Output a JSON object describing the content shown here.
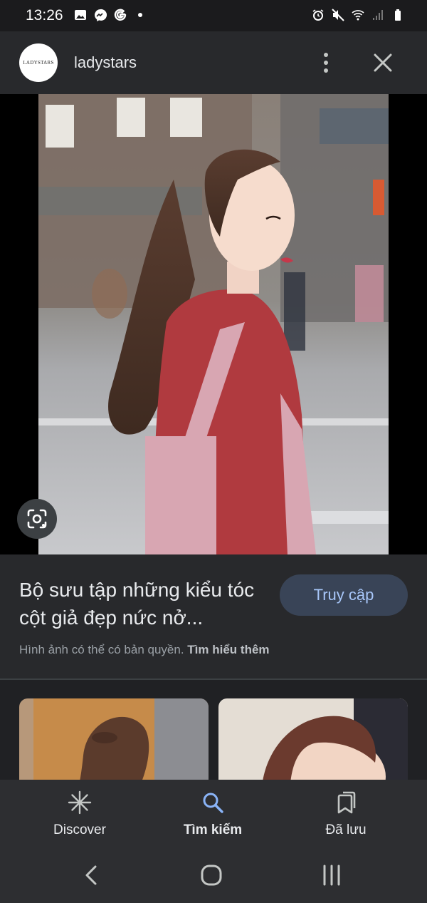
{
  "status_bar": {
    "time": "13:26",
    "left_icons": [
      "gallery-icon",
      "messenger-icon",
      "google-icon",
      "dot-icon"
    ],
    "right_icons": [
      "alarm-icon",
      "mute-icon",
      "wifi-icon",
      "signal-icon",
      "battery-icon"
    ]
  },
  "header": {
    "avatar_text": "LADYSTARS",
    "site_name": "ladystars",
    "more_icon": "more-vert-icon",
    "close_icon": "close-icon"
  },
  "image": {
    "lens_icon": "google-lens-icon"
  },
  "info": {
    "title": "Bộ sưu tập những kiểu tóc cột giả đẹp nức nở...",
    "visit_button": "Truy cập",
    "copyright_text": "Hình ảnh có thể có bản quyền.",
    "learn_more": "Tìm hiểu thêm"
  },
  "bottom_nav": {
    "items": [
      {
        "label": "Discover",
        "icon": "discover-asterisk-icon"
      },
      {
        "label": "Tìm kiếm",
        "icon": "search-icon",
        "active": true
      },
      {
        "label": "Đã lưu",
        "icon": "saved-collections-icon"
      }
    ]
  },
  "system_nav": [
    "back-icon",
    "home-icon",
    "recents-icon"
  ],
  "colors": {
    "background": "#202124",
    "header": "#28292c",
    "visit_button_bg": "#394457",
    "visit_button_text": "#a8c7fa",
    "active_nav": "#8ab4f8"
  }
}
